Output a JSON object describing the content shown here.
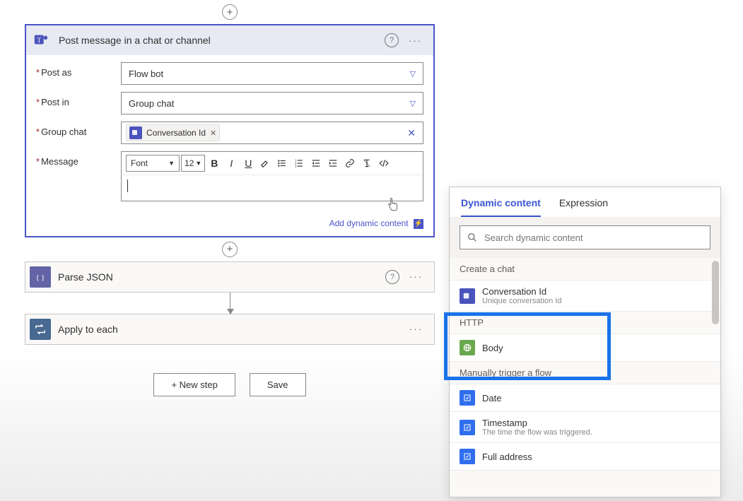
{
  "teams_card": {
    "title": "Post message in a chat or channel",
    "fields": {
      "post_as": {
        "label": "Post as",
        "value": "Flow bot"
      },
      "post_in": {
        "label": "Post in",
        "value": "Group chat"
      },
      "group_chat": {
        "label": "Group chat",
        "token": "Conversation Id"
      },
      "message": {
        "label": "Message"
      }
    },
    "rte": {
      "font": "Font",
      "size": "12"
    },
    "add_dynamic": "Add dynamic content"
  },
  "json_card": {
    "title": "Parse JSON"
  },
  "loop_card": {
    "title": "Apply to each"
  },
  "buttons": {
    "new_step": "+ New step",
    "save": "Save"
  },
  "dynamic_panel": {
    "tabs": {
      "dynamic": "Dynamic content",
      "expression": "Expression"
    },
    "search_placeholder": "Search dynamic content",
    "groups": [
      {
        "header": "Create a chat",
        "items": [
          {
            "icon": "teams",
            "title": "Conversation Id",
            "desc": "Unique conversation Id"
          }
        ]
      },
      {
        "header": "HTTP",
        "items": [
          {
            "icon": "http",
            "title": "Body",
            "desc": ""
          }
        ]
      },
      {
        "header": "Manually trigger a flow",
        "items": [
          {
            "icon": "trig",
            "title": "Date",
            "desc": ""
          },
          {
            "icon": "trig",
            "title": "Timestamp",
            "desc": "The time the flow was triggered."
          },
          {
            "icon": "trig",
            "title": "Full address",
            "desc": ""
          }
        ]
      }
    ]
  }
}
